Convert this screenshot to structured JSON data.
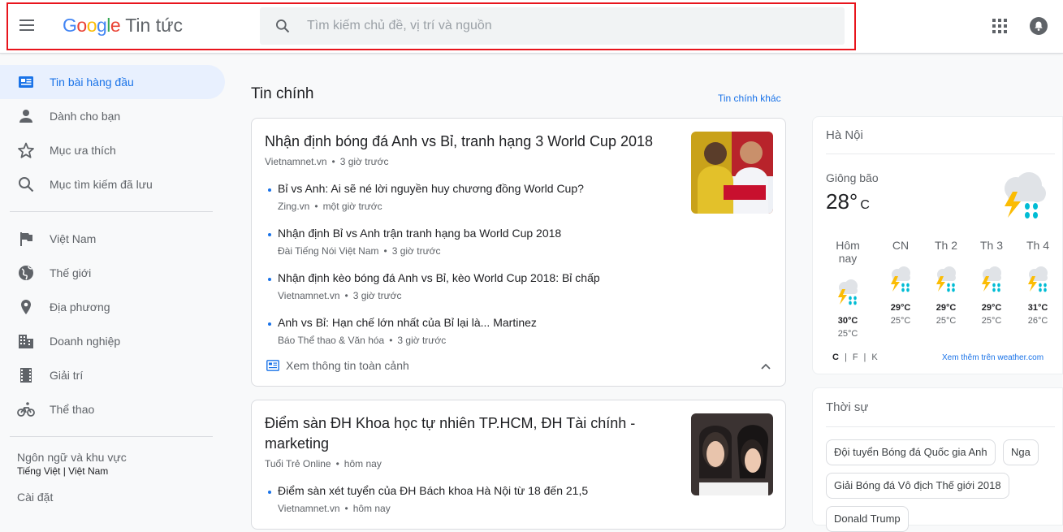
{
  "header": {
    "logo": {
      "g1": "G",
      "o1": "o",
      "o2": "o",
      "g2": "g",
      "l": "l",
      "e": "e"
    },
    "product_name": "Tin tức",
    "search_placeholder": "Tìm kiếm chủ đề, vị trí và nguồn"
  },
  "sidebar": {
    "items": [
      {
        "label": "Tin bài hàng đầu",
        "icon": "top-stories-icon"
      },
      {
        "label": "Dành cho bạn",
        "icon": "person-icon"
      },
      {
        "label": "Mục ưa thích",
        "icon": "star-icon"
      },
      {
        "label": "Mục tìm kiếm đã lưu",
        "icon": "search-icon"
      },
      {
        "label": "Việt Nam",
        "icon": "flag-icon"
      },
      {
        "label": "Thế giới",
        "icon": "globe-icon"
      },
      {
        "label": "Địa phương",
        "icon": "location-pin-icon"
      },
      {
        "label": "Doanh nghiệp",
        "icon": "building-icon"
      },
      {
        "label": "Giải trí",
        "icon": "film-icon"
      },
      {
        "label": "Thể thao",
        "icon": "bicycle-icon"
      }
    ],
    "language_label": "Ngôn ngữ và khu vực",
    "language_value": "Tiếng Việt | Việt Nam",
    "settings_label": "Cài đặt"
  },
  "main": {
    "title": "Tin chính",
    "more_link": "Tin chính khác",
    "articles": [
      {
        "title": "Nhận định bóng đá Anh vs Bỉ, tranh hạng 3 World Cup 2018",
        "source": "Vietnamnet.vn",
        "time": "3 giờ trước",
        "related": [
          {
            "title": "Bỉ vs Anh: Ai sẽ né lời nguyền huy chương đồng World Cup?",
            "source": "Zing.vn",
            "time": "một giờ trước"
          },
          {
            "title": "Nhận định Bỉ vs Anh trận tranh hạng ba World Cup 2018",
            "source": "Đài Tiếng Nói Việt Nam",
            "time": "3 giờ trước"
          },
          {
            "title": "Nhận định kèo bóng đá Anh vs Bỉ, kèo World Cup 2018: Bỉ chấp",
            "source": "Vietnamnet.vn",
            "time": "3 giờ trước"
          },
          {
            "title": "Anh vs Bỉ: Hạn chế lớn nhất của Bỉ lại là... Martinez",
            "source": "Báo Thể thao & Văn hóa",
            "time": "3 giờ trước"
          }
        ],
        "coverage_label": "Xem thông tin toàn cảnh"
      },
      {
        "title": "Điểm sàn ĐH Khoa học tự nhiên TP.HCM, ĐH Tài chính - marketing",
        "source": "Tuổi Trẻ Online",
        "time": "hôm nay",
        "related": [
          {
            "title": "Điểm sàn xét tuyển của ĐH Bách khoa Hà Nội từ 18 đến 21,5",
            "source": "Vietnamnet.vn",
            "time": "hôm nay"
          }
        ]
      }
    ]
  },
  "weather": {
    "city": "Hà Nội",
    "condition": "Giông bão",
    "temp": "28°",
    "unit": "C",
    "days": [
      {
        "name": "Hôm nay",
        "hi": "30°C",
        "lo": "25°C"
      },
      {
        "name": "CN",
        "hi": "29°C",
        "lo": "25°C"
      },
      {
        "name": "Th 2",
        "hi": "29°C",
        "lo": "25°C"
      },
      {
        "name": "Th 3",
        "hi": "29°C",
        "lo": "25°C"
      },
      {
        "name": "Th 4",
        "hi": "31°C",
        "lo": "26°C"
      }
    ],
    "units": [
      "C",
      "F",
      "K"
    ],
    "link": "Xem thêm trên weather.com"
  },
  "topics": {
    "title": "Thời sự",
    "chips": [
      "Đội tuyển Bóng đá Quốc gia Anh",
      "Nga",
      "Giải Bóng đá Vô địch Thế giới 2018",
      "Donald Trump"
    ]
  },
  "colors": {
    "accent": "#1a73e8",
    "highlight_box": "#e8141c",
    "storm_yellow": "#fbbc04",
    "rain_blue": "#00bcd4"
  }
}
